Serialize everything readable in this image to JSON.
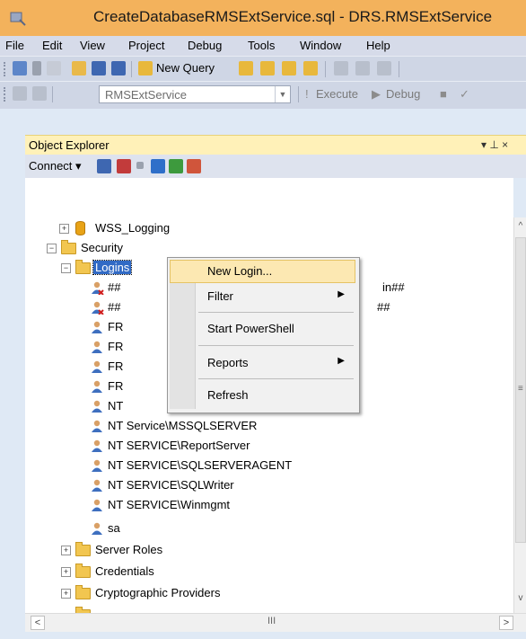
{
  "window": {
    "title": "CreateDatabaseRMSExtService.sql - DRS.RMSExtService"
  },
  "menu": [
    "File",
    "Edit",
    "View",
    "Project",
    "Debug",
    "Tools",
    "Window",
    "Help"
  ],
  "toolbar": {
    "new_query": "New Query",
    "database": "RMSExtService",
    "execute": "Execute",
    "debug": "Debug"
  },
  "object_explorer": {
    "title": "Object Explorer",
    "pin": "▾ ⊥ ×",
    "connect": "Connect ▾",
    "tree": {
      "wss_logging": "WSS_Logging",
      "security": "Security",
      "logins": "Logins",
      "login_items": [
        "##",
        "##",
        "FR",
        "FR",
        "FR",
        "FR",
        "NT",
        "NT Service\\MSSQLSERVER",
        "NT SERVICE\\ReportServer",
        "NT SERVICE\\SQLSERVERAGENT",
        "NT SERVICE\\SQLWriter",
        "NT SERVICE\\Winmgmt",
        "sa"
      ],
      "partial_suffix_1": "in##",
      "partial_suffix_2": "##",
      "server_roles": "Server Roles",
      "credentials": "Credentials",
      "crypto": "Cryptographic Providers"
    }
  },
  "context_menu": {
    "new_login": "New Login...",
    "filter": "Filter",
    "start_powershell": "Start PowerShell",
    "reports": "Reports",
    "refresh": "Refresh"
  },
  "scroll": {
    "grip": "≡",
    "hgrip": "III"
  }
}
